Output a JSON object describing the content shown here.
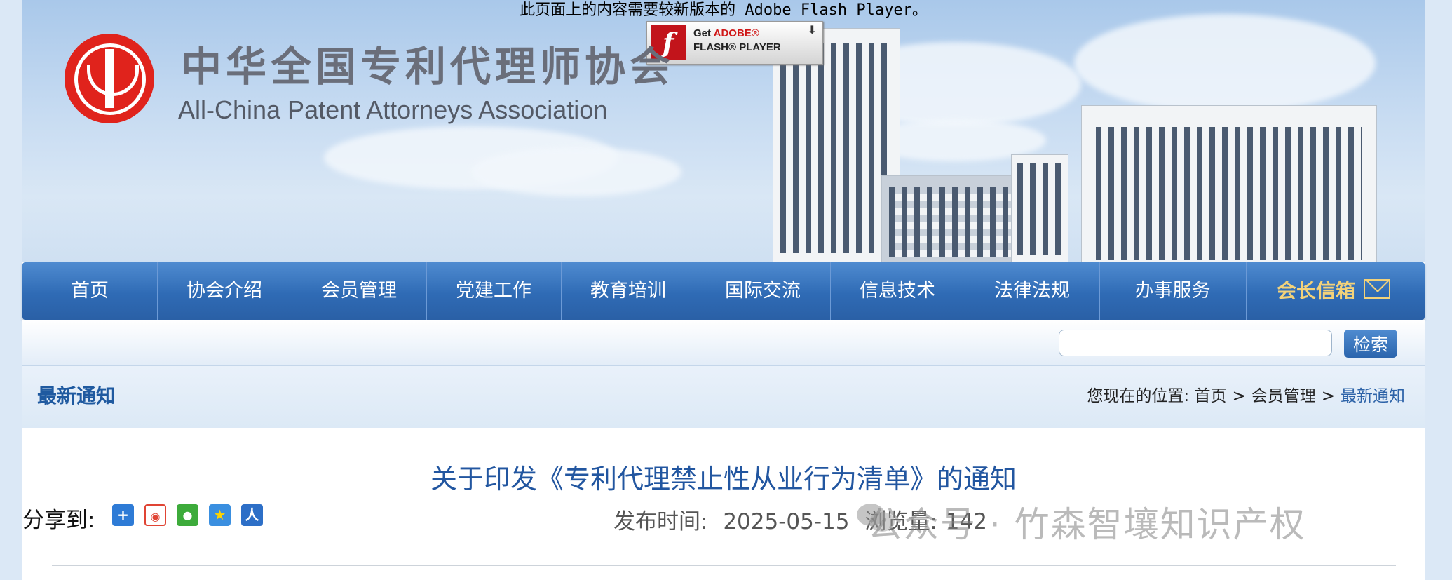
{
  "flash": {
    "message": "此页面上的内容需要较新版本的 Adobe Flash Player。",
    "badge_get": "Get",
    "badge_adobe": "ADOBE®",
    "badge_player": "FLASH® PLAYER"
  },
  "header": {
    "org_name_cn": "中华全国专利代理师协会",
    "org_name_en": "All-China Patent Attorneys Association"
  },
  "nav": {
    "items": [
      "首页",
      "协会介绍",
      "会员管理",
      "党建工作",
      "教育培训",
      "国际交流",
      "信息技术",
      "法律法规",
      "办事服务"
    ],
    "mailbox_label": "会长信箱"
  },
  "search": {
    "placeholder": "",
    "button_label": "检索"
  },
  "section": {
    "title": "最新通知",
    "breadcrumb_prefix": "您现在的位置:",
    "breadcrumb": [
      "首页",
      "会员管理",
      "最新通知"
    ],
    "separator": ">"
  },
  "article": {
    "title": "关于印发《专利代理禁止性从业行为清单》的通知",
    "share_label": "分享到:",
    "publish_label": "发布时间:",
    "publish_date": "2025-05-15",
    "views_label": "浏览量:",
    "views": "142"
  },
  "watermark": {
    "text": "公众号 · 竹森智壤知识产权"
  },
  "colors": {
    "nav_blue": "#2f6bb5",
    "title_blue": "#2256a0",
    "mailbox_gold": "#f3d27a",
    "logo_red": "#e0231c"
  }
}
